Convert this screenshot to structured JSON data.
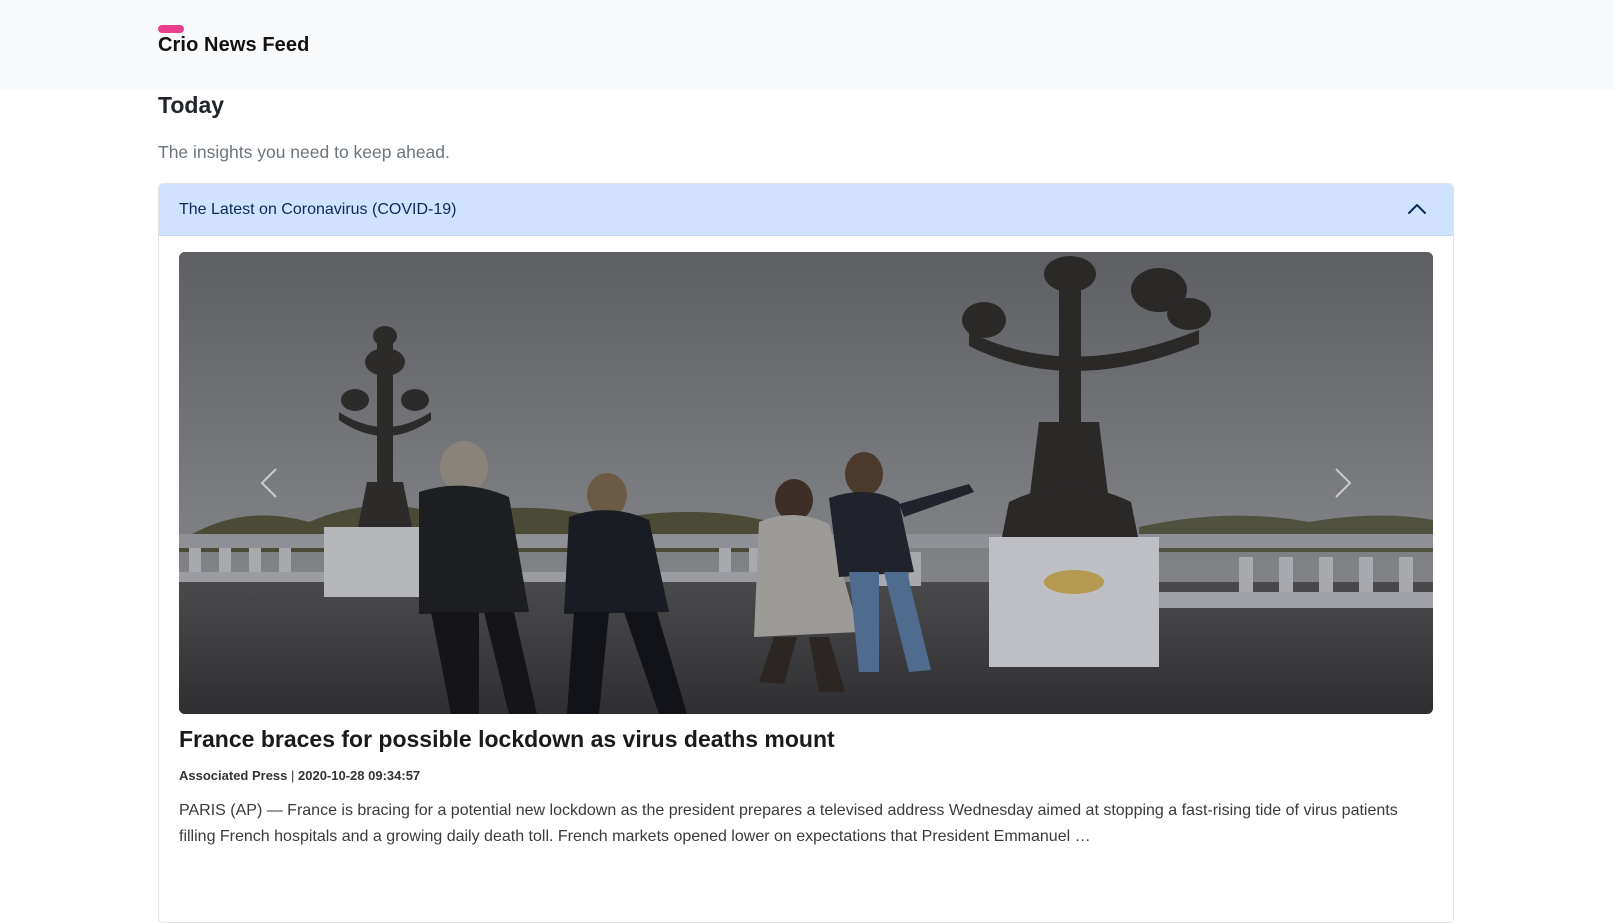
{
  "navbar": {
    "brand": "Crio News Feed",
    "brand_accent_color": "#e83e8c"
  },
  "section": {
    "heading": "Today",
    "tagline": "The insights you need to keep ahead."
  },
  "accordion": {
    "title": "The Latest on Coronavirus (COVID-19)",
    "expanded": true,
    "header_color": "#cfe2ff",
    "toggle_icon": "chevron-up-icon"
  },
  "carousel": {
    "prev_icon": "chevron-left-icon",
    "next_icon": "chevron-right-icon",
    "slide": {
      "title": "France braces for possible lockdown as virus deaths mount",
      "source": "Associated Press",
      "separator": " | ",
      "published": "2020-10-28 09:34:57",
      "summary": "PARIS (AP) — France is bracing for a potential new lockdown as the president prepares a televised address Wednesday aimed at stopping a fast-rising tide of virus patients filling French hospitals and a growing daily death toll. French markets opened lower on expectations that President Emmanuel …"
    }
  }
}
